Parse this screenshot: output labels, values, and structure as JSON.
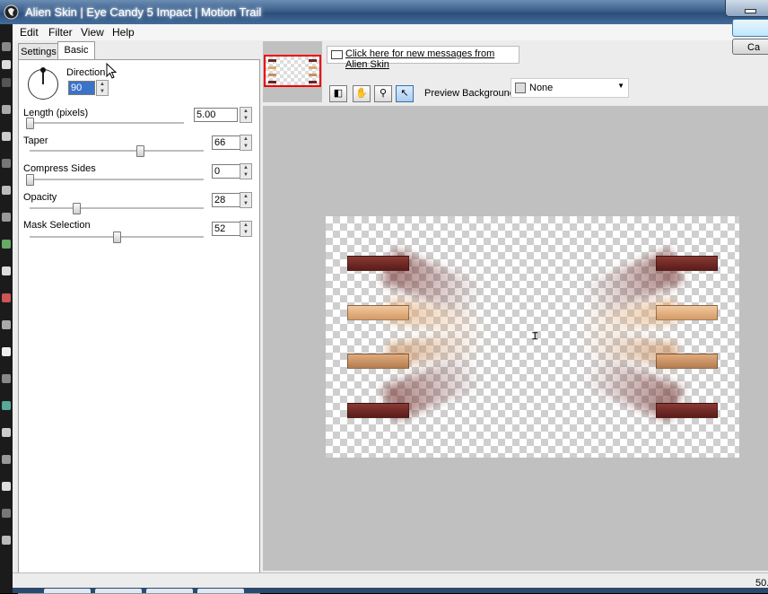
{
  "window": {
    "title": "Alien Skin | Eye Candy 5 Impact | Motion Trail"
  },
  "menu": [
    "Edit",
    "Filter",
    "View",
    "Help"
  ],
  "tabs": {
    "settings": "Settings",
    "basic": "Basic"
  },
  "basic": {
    "direction": {
      "label": "Direction",
      "value": "90"
    },
    "length": {
      "label": "Length (pixels)",
      "value": "5.00",
      "slider": 0.0
    },
    "taper": {
      "label": "Taper",
      "value": "66",
      "slider": 0.66
    },
    "compress_sides": {
      "label": "Compress Sides",
      "value": "0",
      "slider": 0.0
    },
    "opacity": {
      "label": "Opacity",
      "value": "28",
      "slider": 0.28
    },
    "mask_selection": {
      "label": "Mask Selection",
      "value": "52",
      "slider": 0.52
    }
  },
  "message_link": "Click here for new messages from Alien Skin",
  "tools": [
    "preview-toggle-icon",
    "hand-icon",
    "zoom-icon",
    "arrow-icon"
  ],
  "preview_background": {
    "label": "Preview Background:",
    "value": "None"
  },
  "buttons": {
    "ok": "",
    "cancel": "Ca"
  },
  "status": {
    "zoom": "50."
  },
  "colors": {
    "dark_bar": "#6b2622",
    "light_bar": "#e0a874",
    "tan_bar": "#c9905f"
  }
}
